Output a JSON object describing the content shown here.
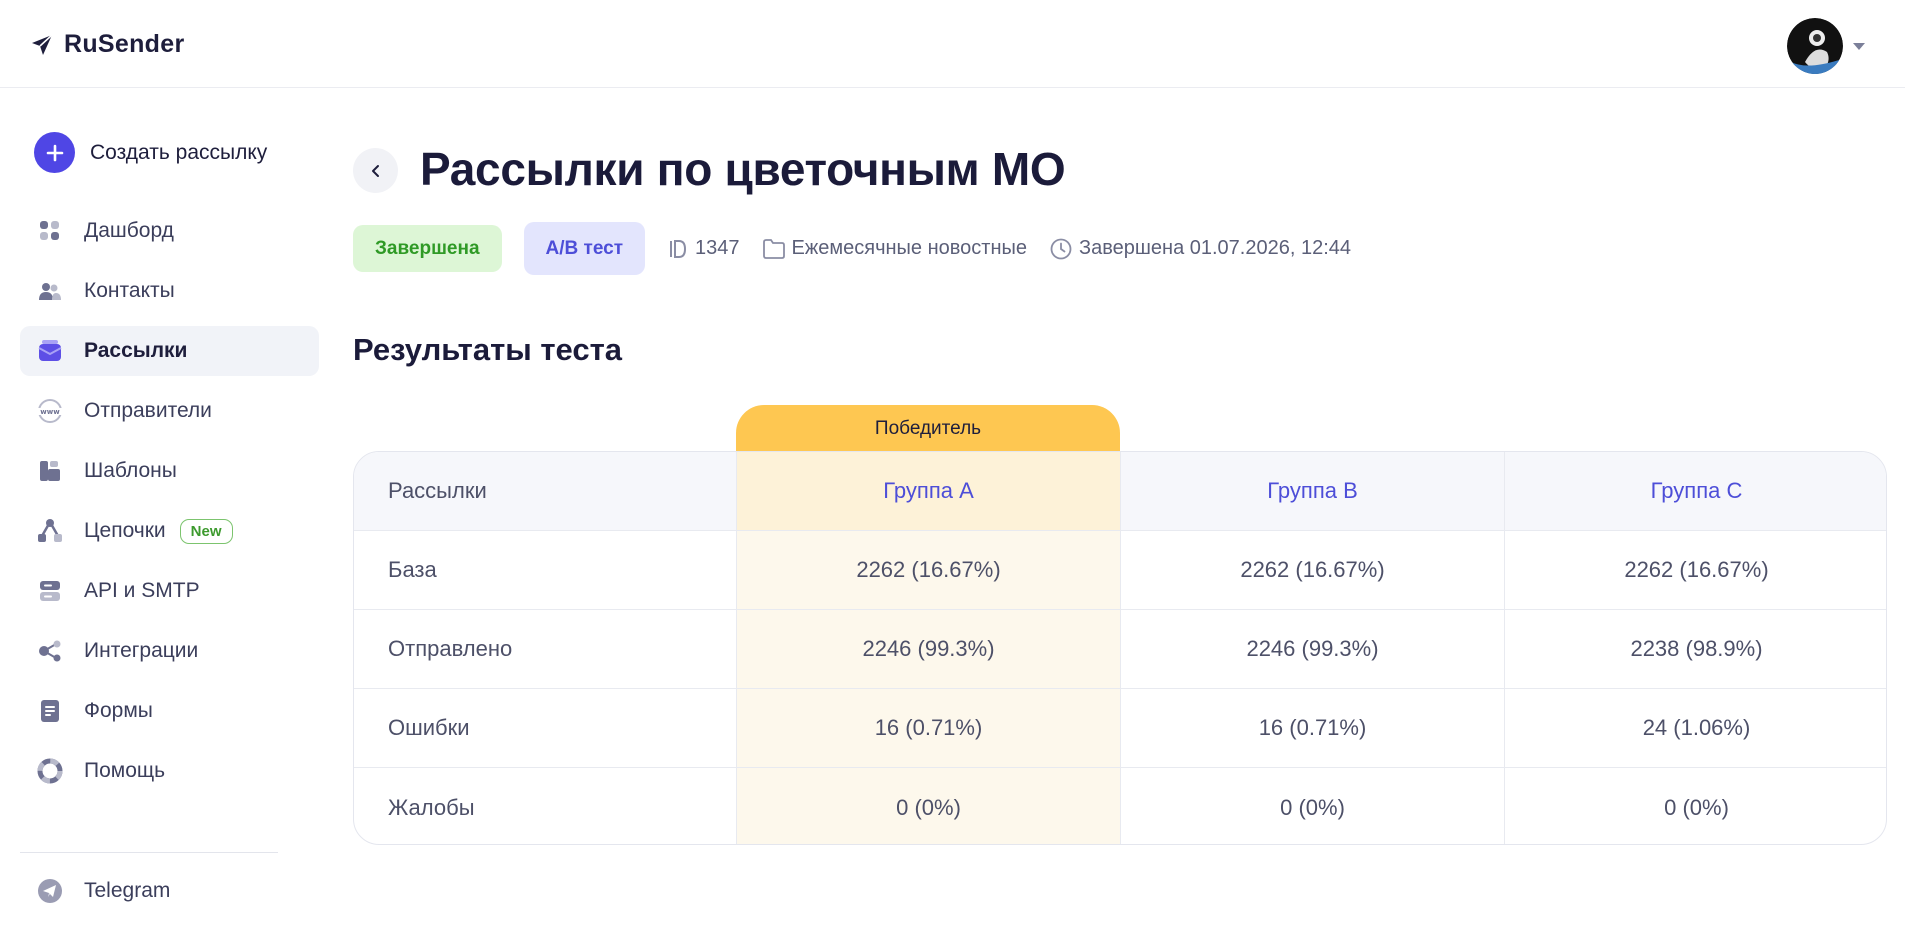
{
  "app": {
    "brand": "RuSender"
  },
  "sidebar": {
    "create_label": "Создать рассылку",
    "items": [
      {
        "label": "Дашборд",
        "icon": "dashboard-icon"
      },
      {
        "label": "Контакты",
        "icon": "contacts-icon"
      },
      {
        "label": "Рассылки",
        "icon": "mailings-icon",
        "active": true
      },
      {
        "label": "Отправители",
        "icon": "www-icon"
      },
      {
        "label": "Шаблоны",
        "icon": "templates-icon"
      },
      {
        "label": "Цепочки",
        "icon": "chains-icon",
        "badge": "New"
      },
      {
        "label": "API и SMTP",
        "icon": "server-icon"
      },
      {
        "label": "Интеграции",
        "icon": "integrations-icon"
      },
      {
        "label": "Формы",
        "icon": "forms-icon"
      },
      {
        "label": "Помощь",
        "icon": "help-icon"
      }
    ],
    "telegram_label": "Telegram"
  },
  "page": {
    "title": "Рассылки по цветочным МО",
    "status": "Завершена",
    "type": "A/B тест",
    "id": "1347",
    "folder": "Ежемесячные новостные",
    "completed": "Завершена 01.07.2026, 12:44"
  },
  "results": {
    "title": "Результаты теста",
    "winner_label": "Победитель",
    "header": [
      "Рассылки",
      "Группа A",
      "Группа B",
      "Группа C"
    ],
    "rows": [
      [
        "База",
        "2262 (16.67%)",
        "2262 (16.67%)",
        "2262 (16.67%)"
      ],
      [
        "Отправлено",
        "2246 (99.3%)",
        "2246 (99.3%)",
        "2238 (98.9%)"
      ],
      [
        "Ошибки",
        "16 (0.71%)",
        "16 (0.71%)",
        "24 (1.06%)"
      ],
      [
        "Жалобы",
        "0 (0%)",
        "0 (0%)",
        "0 (0%)"
      ]
    ]
  },
  "colors": {
    "accent": "#4f46e5",
    "winner": "#fec751",
    "status_done_bg": "#ddf6d6",
    "status_done_text": "#2f9a26"
  }
}
